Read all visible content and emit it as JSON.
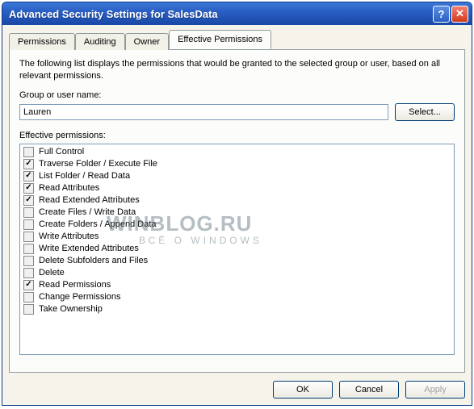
{
  "window": {
    "title": "Advanced Security Settings for SalesData"
  },
  "tabs": [
    {
      "label": "Permissions",
      "active": false
    },
    {
      "label": "Auditing",
      "active": false
    },
    {
      "label": "Owner",
      "active": false
    },
    {
      "label": "Effective Permissions",
      "active": true
    }
  ],
  "intro_text": "The following list displays the permissions that would be granted to the selected group or user, based on all relevant permissions.",
  "group_label": "Group or user name:",
  "group_value": "Lauren",
  "select_button": "Select...",
  "perm_label": "Effective permissions:",
  "permissions": [
    {
      "label": "Full Control",
      "checked": false
    },
    {
      "label": "Traverse Folder / Execute File",
      "checked": true
    },
    {
      "label": "List Folder / Read Data",
      "checked": true
    },
    {
      "label": "Read Attributes",
      "checked": true
    },
    {
      "label": "Read Extended Attributes",
      "checked": true
    },
    {
      "label": "Create Files / Write Data",
      "checked": false
    },
    {
      "label": "Create Folders / Append Data",
      "checked": false
    },
    {
      "label": "Write Attributes",
      "checked": false
    },
    {
      "label": "Write Extended Attributes",
      "checked": false
    },
    {
      "label": "Delete Subfolders and Files",
      "checked": false
    },
    {
      "label": "Delete",
      "checked": false
    },
    {
      "label": "Read Permissions",
      "checked": true
    },
    {
      "label": "Change Permissions",
      "checked": false
    },
    {
      "label": "Take Ownership",
      "checked": false
    }
  ],
  "buttons": {
    "ok": "OK",
    "cancel": "Cancel",
    "apply": "Apply"
  },
  "watermark": {
    "main": "WINBLOG.RU",
    "sub": "ВСЁ О WINDOWS"
  }
}
